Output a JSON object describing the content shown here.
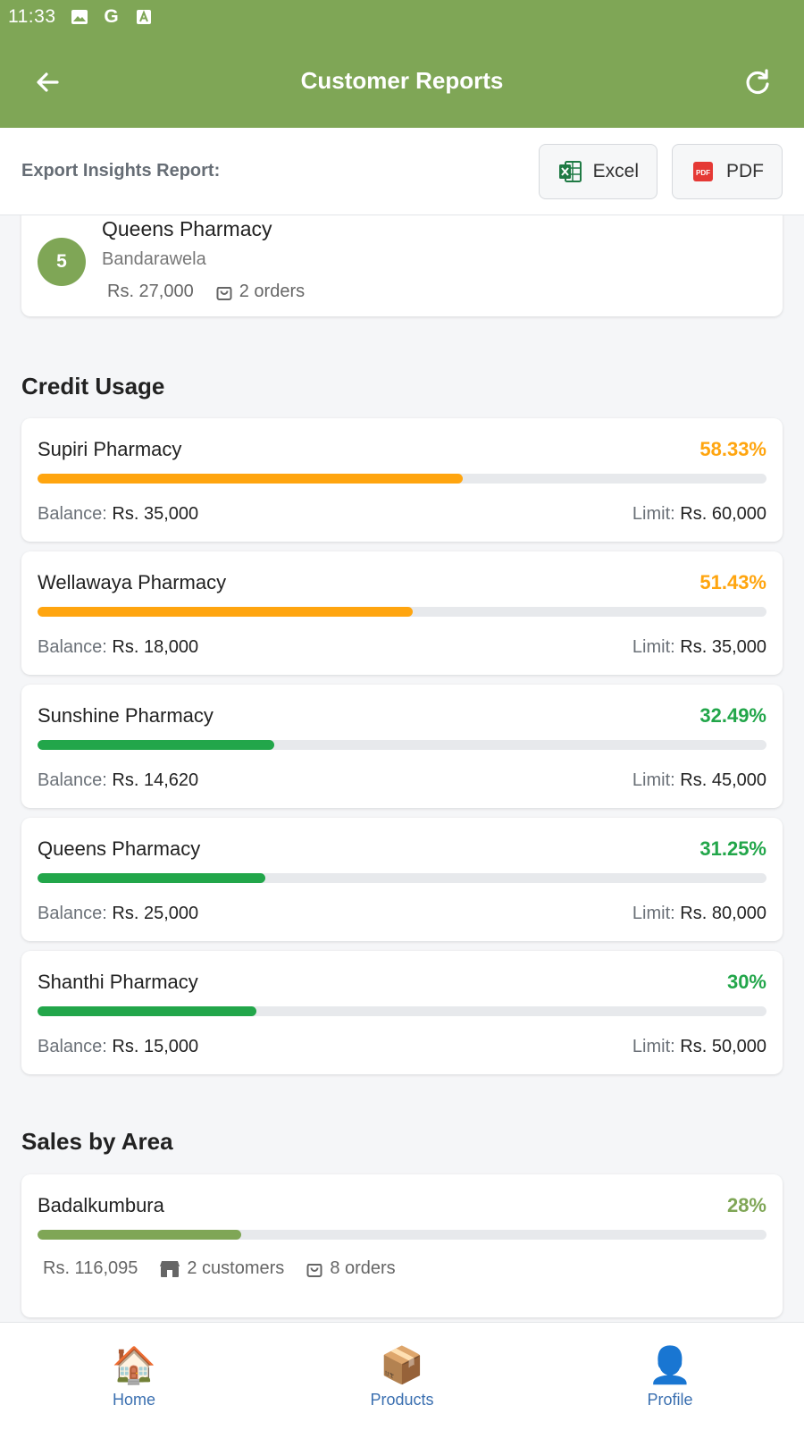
{
  "status_bar": {
    "time": "11:33"
  },
  "header": {
    "title": "Customer Reports"
  },
  "export": {
    "label": "Export Insights Report:",
    "excel_label": "Excel",
    "pdf_label": "PDF"
  },
  "top_customer": {
    "rank": "5",
    "name": "Queens Pharmacy",
    "city": "Bandarawela",
    "amount": "Rs. 27,000",
    "orders": "2 orders"
  },
  "credit_usage": {
    "title": "Credit Usage",
    "balance_label": "Balance:",
    "limit_label": "Limit:",
    "items": [
      {
        "name": "Supiri Pharmacy",
        "percent": "58.33%",
        "fill_fraction": 0.5833,
        "color": "#ffa50f",
        "balance": "Rs. 35,000",
        "limit": "Rs. 60,000"
      },
      {
        "name": "Wellawaya Pharmacy",
        "percent": "51.43%",
        "fill_fraction": 0.5143,
        "color": "#ffa50f",
        "balance": "Rs. 18,000",
        "limit": "Rs. 35,000"
      },
      {
        "name": "Sunshine Pharmacy",
        "percent": "32.49%",
        "fill_fraction": 0.3249,
        "color": "#22a64a",
        "balance": "Rs. 14,620",
        "limit": "Rs. 45,000"
      },
      {
        "name": "Queens Pharmacy",
        "percent": "31.25%",
        "fill_fraction": 0.3125,
        "color": "#22a64a",
        "balance": "Rs. 25,000",
        "limit": "Rs. 80,000"
      },
      {
        "name": "Shanthi Pharmacy",
        "percent": "30%",
        "fill_fraction": 0.3,
        "color": "#22a64a",
        "balance": "Rs. 15,000",
        "limit": "Rs. 50,000"
      }
    ]
  },
  "sales_by_area": {
    "title": "Sales by Area",
    "items": [
      {
        "name": "Badalkumbura",
        "percent": "28%",
        "fill_fraction": 0.28,
        "color": "#7fa656",
        "amount": "Rs. 116,095",
        "customers": "2 customers",
        "orders": "8 orders"
      }
    ]
  },
  "bottom_nav": [
    {
      "label": "Home",
      "icon": "🏠"
    },
    {
      "label": "Products",
      "icon": "📦"
    },
    {
      "label": "Profile",
      "icon": "👤"
    }
  ],
  "colors": {
    "primary": "#7fa656",
    "warning": "#ffa50f",
    "success": "#22a64a",
    "nav_label": "#3a6fb0"
  }
}
